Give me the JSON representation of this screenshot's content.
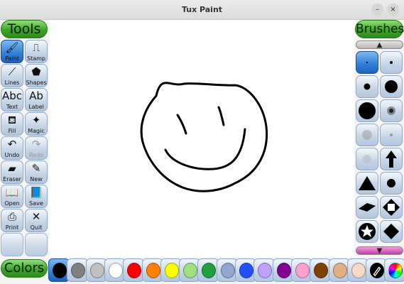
{
  "window": {
    "title": "Tux Paint",
    "minimize_glyph": "–",
    "close_glyph": "×"
  },
  "headers": {
    "tools": "Tools",
    "brushes": "Brushes",
    "colors": "Colors"
  },
  "tools": [
    {
      "label": "Paint",
      "icon": "paint-brush-icon",
      "glyph": "🖌",
      "active": true
    },
    {
      "label": "Stamp",
      "icon": "stamp-icon",
      "glyph": "⎍"
    },
    {
      "label": "Lines",
      "icon": "lines-icon",
      "glyph": "⟋"
    },
    {
      "label": "Shapes",
      "icon": "shapes-icon",
      "glyph": "⬟"
    },
    {
      "label": "Text",
      "icon": "text-icon",
      "glyph": "Abc"
    },
    {
      "label": "Label",
      "icon": "label-icon",
      "glyph": "Ab"
    },
    {
      "label": "Fill",
      "icon": "fill-bucket-icon",
      "glyph": "⛾"
    },
    {
      "label": "Magic",
      "icon": "magic-wand-icon",
      "glyph": "✦"
    },
    {
      "label": "Undo",
      "icon": "undo-icon",
      "glyph": "↶"
    },
    {
      "label": "Redo",
      "icon": "redo-icon",
      "glyph": "↷",
      "disabled": true
    },
    {
      "label": "Eraser",
      "icon": "eraser-icon",
      "glyph": "▰"
    },
    {
      "label": "New",
      "icon": "new-document-icon",
      "glyph": "✎"
    },
    {
      "label": "Open",
      "icon": "open-book-icon",
      "glyph": "📖"
    },
    {
      "label": "Save",
      "icon": "save-book-icon",
      "glyph": "📘"
    },
    {
      "label": "Print",
      "icon": "printer-icon",
      "glyph": "⎙"
    },
    {
      "label": "Quit",
      "icon": "quit-icon",
      "glyph": "✕"
    }
  ],
  "brushes": [
    {
      "icon": "brush-tiny-dot-icon",
      "active": true
    },
    {
      "icon": "brush-small-dot-icon"
    },
    {
      "icon": "brush-medium-dot-icon"
    },
    {
      "icon": "brush-large-dot-icon"
    },
    {
      "icon": "brush-xlarge-dot-icon"
    },
    {
      "icon": "brush-fuzzy-dot-icon"
    },
    {
      "icon": "brush-faded-dot-icon"
    },
    {
      "icon": "brush-faint-dot-icon"
    },
    {
      "icon": "brush-light-dot-icon"
    },
    {
      "icon": "brush-arrow-up-icon"
    },
    {
      "icon": "brush-triangle-icon"
    },
    {
      "icon": "brush-circle-icon"
    },
    {
      "icon": "brush-diamond-flat-icon"
    },
    {
      "icon": "brush-square-rotate-icon"
    },
    {
      "icon": "brush-star-icon"
    },
    {
      "icon": "brush-diamond-icon"
    }
  ],
  "colors": [
    {
      "name": "black",
      "hex": "#000000",
      "active": true
    },
    {
      "name": "dark-gray",
      "hex": "#808080"
    },
    {
      "name": "light-gray",
      "hex": "#c0c0c0"
    },
    {
      "name": "white",
      "hex": "#ffffff"
    },
    {
      "name": "red",
      "hex": "#ff0000"
    },
    {
      "name": "orange",
      "hex": "#ff8000"
    },
    {
      "name": "yellow",
      "hex": "#ffff00"
    },
    {
      "name": "light-green",
      "hex": "#a0e080"
    },
    {
      "name": "green",
      "hex": "#20a040"
    },
    {
      "name": "steel-blue",
      "hex": "#90a8d0"
    },
    {
      "name": "blue",
      "hex": "#2050ff"
    },
    {
      "name": "lavender",
      "hex": "#c0a0ff"
    },
    {
      "name": "purple",
      "hex": "#800090"
    },
    {
      "name": "pink",
      "hex": "#ffa0d0"
    },
    {
      "name": "brown",
      "hex": "#804000"
    },
    {
      "name": "tan",
      "hex": "#e0b080"
    },
    {
      "name": "peach",
      "hex": "#f8d8c8"
    },
    {
      "name": "color-picker",
      "hex": "#000000"
    },
    {
      "name": "rainbow",
      "hex": "#ff00ff"
    }
  ],
  "theme": {
    "accent_green": "#3ea528",
    "active_blue": "#2f7fd8",
    "button_blue": "#c4d4e6",
    "canvas": "#ffffff"
  }
}
